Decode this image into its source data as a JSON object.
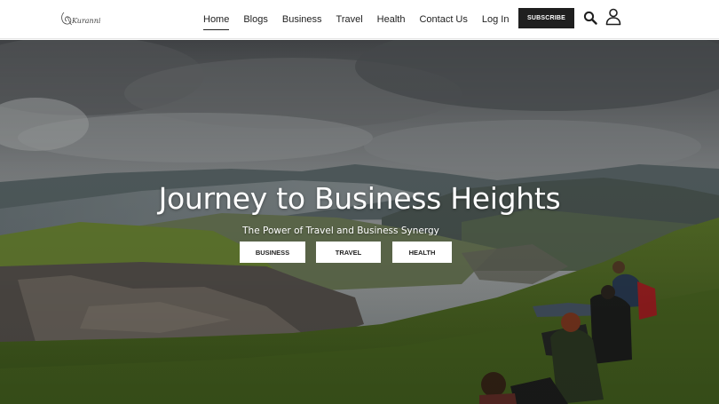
{
  "header": {
    "logo_text": "Kuranni",
    "nav": [
      {
        "label": "Home",
        "active": true
      },
      {
        "label": "Blogs",
        "active": false
      },
      {
        "label": "Business",
        "active": false
      },
      {
        "label": "Travel",
        "active": false
      },
      {
        "label": "Health",
        "active": false
      },
      {
        "label": "Contact Us",
        "active": false
      },
      {
        "label": "Log In",
        "active": false
      }
    ],
    "subscribe_label": "SUBSCRIBE",
    "icons": [
      "search-icon",
      "user-icon"
    ]
  },
  "hero": {
    "title": "Journey to Business Heights",
    "subtitle": "The Power of Travel and Business Synergy",
    "buttons": [
      {
        "label": "BUSINESS"
      },
      {
        "label": "TRAVEL"
      },
      {
        "label": "HEALTH"
      }
    ]
  },
  "colors": {
    "header_bg": "#ffffff",
    "nav_text": "#222222",
    "subscribe_bg": "#1f1f1f",
    "subscribe_text": "#ffffff",
    "hero_button_bg": "#ffffff",
    "hero_text": "#ffffff"
  }
}
